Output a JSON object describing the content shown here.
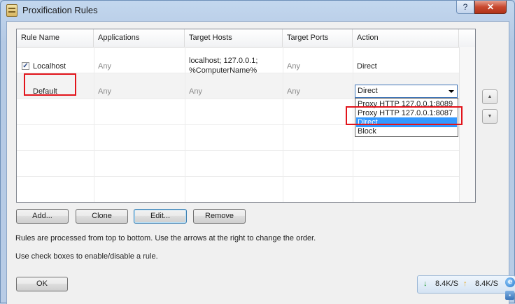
{
  "window": {
    "title": "Proxification Rules",
    "help_label": "?",
    "close_label": "✕"
  },
  "table": {
    "columns": [
      "Rule Name",
      "Applications",
      "Target Hosts",
      "Target Ports",
      "Action"
    ],
    "rows": [
      {
        "checked": true,
        "name": "Localhost",
        "applications": "Any",
        "hosts_line1": "localhost; 127.0.0.1;",
        "hosts_line2": "%ComputerName%",
        "ports": "Any",
        "action": "Direct"
      },
      {
        "name": "Default",
        "applications": "Any",
        "hosts": "Any",
        "ports": "Any",
        "action": "Direct"
      }
    ],
    "action_options": [
      "Proxy HTTP 127.0.0.1:8089",
      "Proxy HTTP 127.0.0.1:8087",
      "Direct",
      "Block"
    ],
    "highlighted_option": "Direct"
  },
  "buttons": {
    "add": "Add...",
    "clone": "Clone",
    "edit": "Edit...",
    "remove": "Remove",
    "ok": "OK",
    "move_up": "▲",
    "move_down": "▼"
  },
  "notes": {
    "order": "Rules are processed from top to bottom. Use the arrows at the right to change the order.",
    "checkbox": "Use check boxes to enable/disable a rule."
  },
  "tray": {
    "download_speed": "8.4K/S",
    "upload_speed": "8.4K/S",
    "download_icon": "arrow-down-icon",
    "upload_icon": "arrow-up-icon"
  },
  "colors": {
    "highlight": "#3399ff",
    "annotation": "#e2141b"
  }
}
